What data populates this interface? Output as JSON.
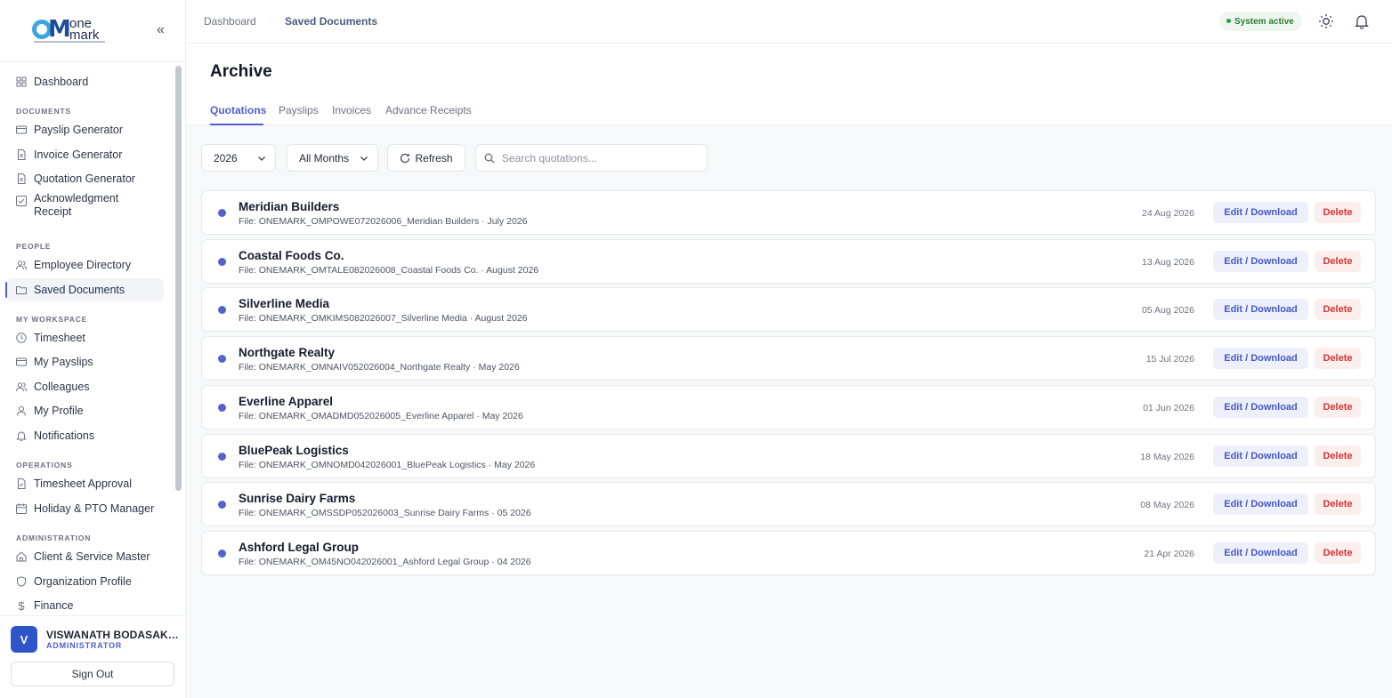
{
  "app": {
    "name": "OneMark",
    "logo_one": "one",
    "logo_mark": "mark"
  },
  "sidebar": {
    "sections": {
      "documents": "DOCUMENTS",
      "people": "PEOPLE",
      "workspace": "MY WORKSPACE",
      "operations": "OPERATIONS",
      "administration": "ADMINISTRATION"
    },
    "items": {
      "dashboard": "Dashboard",
      "payslip_generator": "Payslip Generator",
      "invoice_generator": "Invoice Generator",
      "quotation_generator": "Quotation Generator",
      "acknowledgment_receipt_1": "Acknowledgment",
      "acknowledgment_receipt_2": "Receipt",
      "employee_directory": "Employee Directory",
      "saved_documents": "Saved Documents",
      "timesheet": "Timesheet",
      "my_payslips": "My Payslips",
      "colleagues": "Colleagues",
      "my_profile": "My Profile",
      "notifications": "Notifications",
      "timesheet_approval": "Timesheet Approval",
      "holiday_pto": "Holiday & PTO Manager",
      "client_service_master": "Client & Service Master",
      "organization_profile": "Organization Profile",
      "finance": "Finance"
    },
    "active_item": "saved_documents"
  },
  "user": {
    "initial": "V",
    "name": "VISWANATH BODASAK…",
    "role": "ADMINISTRATOR",
    "sign_out": "Sign Out"
  },
  "topbar": {
    "breadcrumb": [
      "Dashboard",
      "Saved Documents"
    ],
    "breadcrumb_sep": "·",
    "status": "System active",
    "status_color": "#22a045"
  },
  "page": {
    "title": "Archive",
    "tabs": [
      "Quotations",
      "Payslips",
      "Invoices",
      "Advance Receipts"
    ],
    "active_tab": "Quotations"
  },
  "filters": {
    "year": "2026",
    "month": "All Months",
    "refresh": "Refresh",
    "search_placeholder": "Search quotations..."
  },
  "actions": {
    "edit": "Edit / Download",
    "delete": "Delete"
  },
  "colors": {
    "accent": "#4f5fcf",
    "delete": "#d93434"
  },
  "documents": [
    {
      "name": "Meridian Builders",
      "file": "File: ONEMARK_OMPOWE072026006_Meridian Builders · July 2026",
      "date": "24 Aug 2026"
    },
    {
      "name": "Coastal Foods Co.",
      "file": "File: ONEMARK_OMTALE082026008_Coastal Foods Co. · August 2026",
      "date": "13 Aug 2026"
    },
    {
      "name": "Silverline Media",
      "file": "File: ONEMARK_OMKIMS082026007_Silverline Media · August 2026",
      "date": "05 Aug 2026"
    },
    {
      "name": "Northgate Realty",
      "file": "File: ONEMARK_OMNAIV052026004_Northgate Realty · May 2026",
      "date": "15 Jul 2026"
    },
    {
      "name": "Everline Apparel",
      "file": "File: ONEMARK_OMADMD052026005_Everline Apparel · May 2026",
      "date": "01 Jun 2026"
    },
    {
      "name": "BluePeak Logistics",
      "file": "File: ONEMARK_OMNOMD042026001_BluePeak Logistics · May 2026",
      "date": "18 May 2026"
    },
    {
      "name": "Sunrise Dairy Farms",
      "file": "File: ONEMARK_OMSSDP052026003_Sunrise Dairy Farms · 05 2026",
      "date": "08 May 2026"
    },
    {
      "name": "Ashford Legal Group",
      "file": "File: ONEMARK_OM45NO042026001_Ashford Legal Group · 04 2026",
      "date": "21 Apr 2026"
    }
  ]
}
